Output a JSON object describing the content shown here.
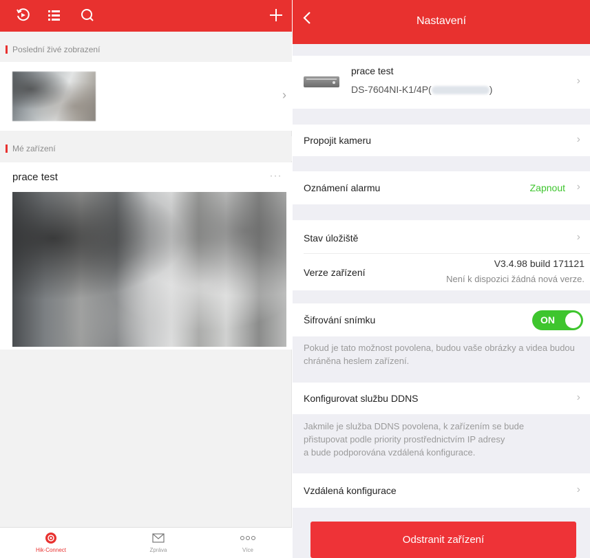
{
  "left": {
    "section_recent": "Poslední živé zobrazení",
    "section_devices": "Mé zařízení",
    "device": {
      "name": "prace test",
      "menu": "···"
    },
    "nav": [
      {
        "label": "Hik-Connect",
        "icon": "hik-connect-icon",
        "active": true
      },
      {
        "label": "Zpráva",
        "icon": "envelope-icon",
        "active": false
      },
      {
        "label": "Více",
        "icon": "more-dots-icon",
        "active": false
      }
    ]
  },
  "right": {
    "title": "Nastavení",
    "device": {
      "name": "prace test",
      "model_prefix": "DS-7604NI-K1/4P(",
      "model_suffix": ")"
    },
    "link_camera": "Propojit kameru",
    "alarm": {
      "label": "Oznámení alarmu",
      "value": "Zapnout"
    },
    "storage": "Stav úložiště",
    "version": {
      "label": "Verze zařízení",
      "value": "V3.4.98 build 171121",
      "note": "Není k dispozici žádná nová verze."
    },
    "encryption": {
      "label": "Šifrování snímku",
      "toggle": "ON",
      "desc": "Pokud je tato možnost povolena, budou vaše obrázky a videa budou chráněna heslem zařízení."
    },
    "ddns": {
      "label": "Konfigurovat službu DDNS",
      "desc_l1": "Jakmile je služba DDNS povolena, k zařízením se bude",
      "desc_l2": "přistupovat podle priority prostřednictvím IP adresy",
      "desc_l3": "a bude podporována vzdálená konfigurace."
    },
    "remote": "Vzdálená konfigurace",
    "remove_button": "Odstranit zařízení"
  },
  "colors": {
    "accent": "#e8312f",
    "toggle_on": "#3ec52e",
    "alarm_value": "#3ec52e"
  }
}
